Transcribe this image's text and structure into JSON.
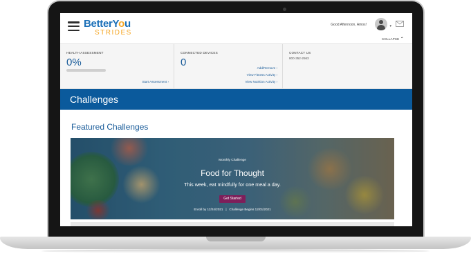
{
  "header": {
    "logo_main": "BetterY",
    "logo_accent": "o",
    "logo_end": "u",
    "logo_sub": "STRIDES",
    "greeting": "Good Afternoon, Amos!",
    "collapse_label": "COLLAPSE",
    "icons": {
      "menu": "hamburger-icon",
      "avatar": "user-avatar",
      "mail": "mail-icon",
      "collapse": "chevron-up-icon"
    }
  },
  "summary": {
    "health": {
      "label": "HEALTH ASSESSMENT",
      "value": "0%",
      "progress_fraction": 0,
      "link": "Start Assessment"
    },
    "devices": {
      "label": "CONNECTED DEVICES",
      "value": "0",
      "links": [
        "Add/Remove",
        "View Fitness Activity",
        "View Nutrition Activity"
      ]
    },
    "contact": {
      "label": "CONTACT US",
      "phone": "800-352-2563"
    },
    "link_arrow": "›"
  },
  "banner": {
    "title": "Challenges"
  },
  "featured": {
    "title": "Featured Challenges",
    "card": {
      "eyebrow": "Monthly Challenge",
      "title": "Food for Thought",
      "subtitle": "This week, eat mindfully for one meal a day.",
      "button": "Get Started",
      "enroll": "Enroll by 12/24/2021",
      "separator": "|",
      "begins": "Challenge Begins 12/01/2021"
    }
  },
  "colors": {
    "brand_blue": "#1a5c9a",
    "banner_blue": "#0b5a9c",
    "accent_orange": "#f5a623",
    "button_purple": "#7e1e5a"
  }
}
